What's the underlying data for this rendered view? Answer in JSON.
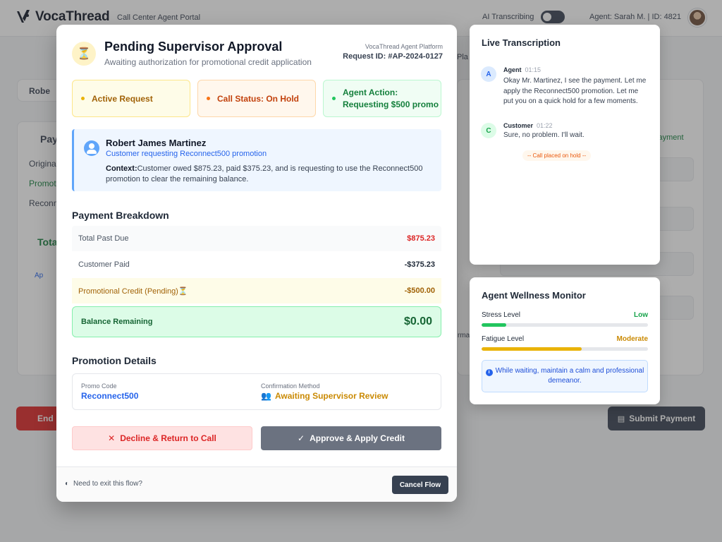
{
  "app": {
    "brand": "VocaThread",
    "portal": "Call Center Agent Portal",
    "ai_label": "AI Transcribing",
    "agent": "Agent: Sarah M. | ID: 4821"
  },
  "background": {
    "customer_label": "Robe",
    "payment_title": "Pay",
    "row_original": "Origina",
    "row_promo": "Promot",
    "row_reconnect": "Reconn",
    "total": "Tota",
    "apply": "Ap",
    "end_call": "End",
    "submit": "Submit Payment",
    "right_link": "e Payment",
    "plan_fragment": "Pla",
    "form_fragment": "rma"
  },
  "modal": {
    "title": "Pending Supervisor Approval",
    "subtitle": "Awaiting authorization for promotional credit application",
    "platform": "VocaThread Agent Platform",
    "request_id": "Request ID: #AP-2024-0127",
    "status": {
      "active": "Active Request",
      "call": "Call Status: On Hold",
      "agent_line1": "Agent Action:",
      "agent_line2": "Requesting $500 promo"
    },
    "customer": {
      "name": "Robert James Martinez",
      "request": "Customer requesting Reconnect500 promotion",
      "context_label": "Context:",
      "context": "Customer owed $875.23, paid $375.23, and is requesting to use the Reconnect500 promotion to clear the remaining balance."
    },
    "payment": {
      "title": "Payment Breakdown",
      "rows": [
        {
          "label": "Total Past Due",
          "value": "$875.23"
        },
        {
          "label": "Customer Paid",
          "value": "-$375.23"
        },
        {
          "label": "Promotional Credit (Pending)",
          "value": "-$500.00"
        }
      ],
      "balance_label": "Balance Remaining",
      "balance_value": "$0.00"
    },
    "promotion": {
      "title": "Promotion Details",
      "code_label": "Promo Code",
      "code_value": "Reconnect500",
      "method_label": "Confirmation Method",
      "method_value": "Awaiting Supervisor Review"
    },
    "buttons": {
      "decline": "Decline & Return to Call",
      "approve": "Approve & Apply Credit"
    },
    "footer": {
      "exit": "Need to exit this flow?",
      "cancel": "Cancel Flow"
    }
  },
  "transcription": {
    "title": "Live Transcription",
    "messages": [
      {
        "avatar": "A",
        "speaker": "Agent",
        "time": "01:15",
        "text": "Okay Mr. Martinez, I see the payment. Let me apply the Reconnect500 promotion. Let me put you on a quick hold for a few moments."
      },
      {
        "avatar": "C",
        "speaker": "Customer",
        "time": "01:22",
        "text": "Sure, no problem. I'll wait."
      }
    ],
    "hold_note": "-- Call placed on hold --"
  },
  "wellness": {
    "title": "Agent Wellness Monitor",
    "stress_label": "Stress Level",
    "stress_value": "Low",
    "stress_level": 0.15,
    "fatigue_label": "Fatigue Level",
    "fatigue_value": "Moderate",
    "fatigue_level": 0.6,
    "tip": "While waiting, maintain a calm and professional demeanor.",
    "colors": {
      "low": "#22c55e",
      "moderate": "#eab308"
    }
  }
}
